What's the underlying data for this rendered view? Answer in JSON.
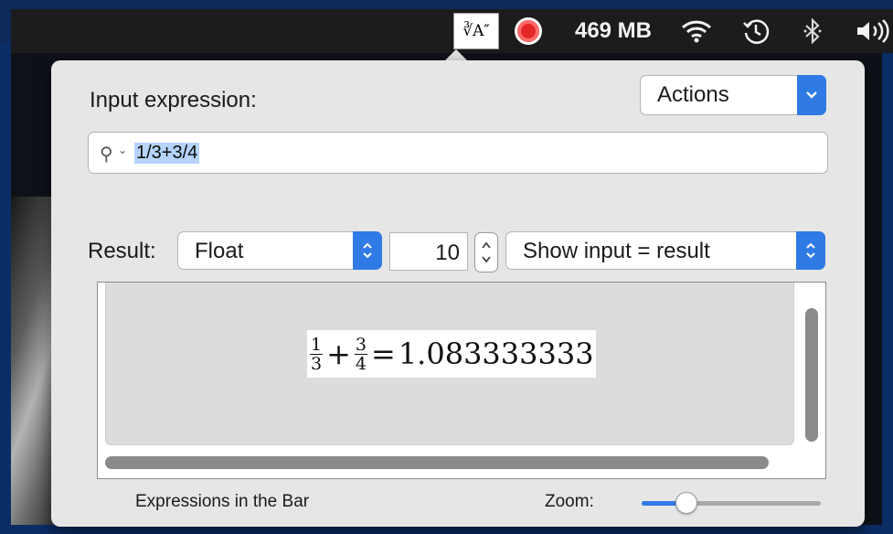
{
  "menubar": {
    "app_icon_text": "∛A″",
    "memory": "469 MB",
    "icons": [
      "latex-app-icon",
      "record-icon",
      "wifi-icon",
      "time-machine-icon",
      "bluetooth-icon",
      "volume-icon"
    ]
  },
  "popover": {
    "input_label": "Input expression:",
    "actions_label": "Actions",
    "expression_value": "1/3+3/4",
    "result_label": "Result:",
    "result_type": "Float",
    "precision": "10",
    "display_mode": "Show input = result",
    "formula": {
      "frac1_num": "1",
      "frac1_den": "3",
      "plus": "+",
      "frac2_num": "3",
      "frac2_den": "4",
      "equals": "=",
      "result": "1.083333333"
    },
    "footer_label": "Expressions in the Bar",
    "zoom_label": "Zoom:",
    "zoom_level": 0.25
  },
  "colors": {
    "accent": "#2f7ae5",
    "menubar_bg": "#1c1c1e",
    "popover_bg": "#e6e6e6",
    "selection": "#b5d3fb"
  }
}
